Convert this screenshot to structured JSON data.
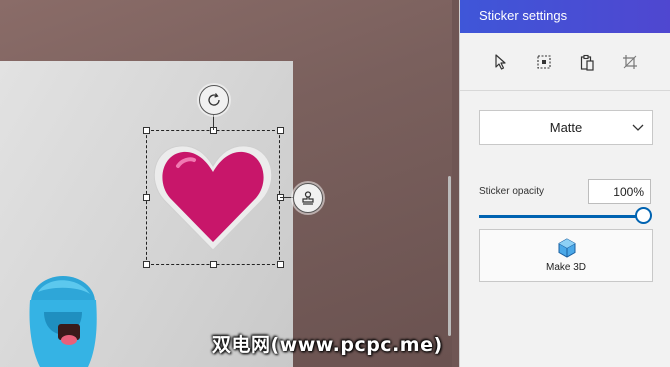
{
  "panel": {
    "title": "Sticker settings",
    "tools": [
      {
        "name": "select",
        "icon": "cursor-icon"
      },
      {
        "name": "crop-select",
        "icon": "select-box-icon"
      },
      {
        "name": "paste",
        "icon": "clipboard-icon"
      },
      {
        "name": "crop",
        "icon": "crop-icon"
      }
    ],
    "finish": {
      "selected": "Matte"
    },
    "opacity": {
      "label": "Sticker opacity",
      "value": "100%",
      "fraction": 1.0
    },
    "make3d": {
      "label": "Make 3D",
      "icon": "cube-icon"
    }
  },
  "canvas": {
    "sticker": "heart-sticker",
    "controls": [
      "rotate-icon",
      "stamp-icon"
    ]
  },
  "watermark": "双电网(www.pcpc.me)",
  "colors": {
    "accent": "#0063b1",
    "header": "#4b4fd6",
    "heart": "#c8166a"
  }
}
